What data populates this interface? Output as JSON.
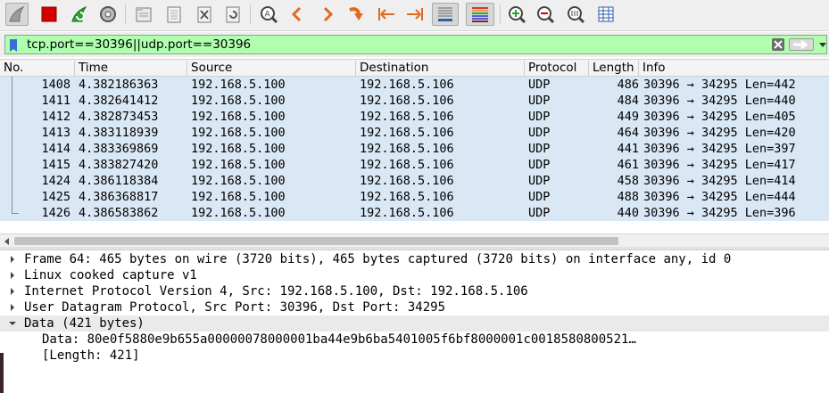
{
  "filter": {
    "value": "tcp.port==30396||udp.port==30396"
  },
  "columns": [
    "No.",
    "Time",
    "Source",
    "Destination",
    "Protocol",
    "Length",
    "Info"
  ],
  "packets": [
    {
      "no": "1408",
      "time": "4.382186363",
      "source": "192.168.5.100",
      "destination": "192.168.5.106",
      "protocol": "UDP",
      "length": "486",
      "info": "30396 → 34295 Len=442"
    },
    {
      "no": "1411",
      "time": "4.382641412",
      "source": "192.168.5.100",
      "destination": "192.168.5.106",
      "protocol": "UDP",
      "length": "484",
      "info": "30396 → 34295 Len=440"
    },
    {
      "no": "1412",
      "time": "4.382873453",
      "source": "192.168.5.100",
      "destination": "192.168.5.106",
      "protocol": "UDP",
      "length": "449",
      "info": "30396 → 34295 Len=405"
    },
    {
      "no": "1413",
      "time": "4.383118939",
      "source": "192.168.5.100",
      "destination": "192.168.5.106",
      "protocol": "UDP",
      "length": "464",
      "info": "30396 → 34295 Len=420"
    },
    {
      "no": "1414",
      "time": "4.383369869",
      "source": "192.168.5.100",
      "destination": "192.168.5.106",
      "protocol": "UDP",
      "length": "441",
      "info": "30396 → 34295 Len=397"
    },
    {
      "no": "1415",
      "time": "4.383827420",
      "source": "192.168.5.100",
      "destination": "192.168.5.106",
      "protocol": "UDP",
      "length": "461",
      "info": "30396 → 34295 Len=417"
    },
    {
      "no": "1424",
      "time": "4.386118384",
      "source": "192.168.5.100",
      "destination": "192.168.5.106",
      "protocol": "UDP",
      "length": "458",
      "info": "30396 → 34295 Len=414"
    },
    {
      "no": "1425",
      "time": "4.386368817",
      "source": "192.168.5.100",
      "destination": "192.168.5.106",
      "protocol": "UDP",
      "length": "488",
      "info": "30396 → 34295 Len=444"
    },
    {
      "no": "1426",
      "time": "4.386583862",
      "source": "192.168.5.100",
      "destination": "192.168.5.106",
      "protocol": "UDP",
      "length": "440",
      "info": "30396 → 34295 Len=396"
    }
  ],
  "details": [
    {
      "text": "Frame 64: 465 bytes on wire (3720 bits), 465 bytes captured (3720 bits) on interface any, id 0",
      "expander": "collapsed"
    },
    {
      "text": "Linux cooked capture v1",
      "expander": "collapsed"
    },
    {
      "text": "Internet Protocol Version 4, Src: 192.168.5.100, Dst: 192.168.5.106",
      "expander": "collapsed"
    },
    {
      "text": "User Datagram Protocol, Src Port: 30396, Dst Port: 34295",
      "expander": "collapsed"
    },
    {
      "text": "Data (421 bytes)",
      "expander": "expanded"
    },
    {
      "text": "Data: 80e0f5880e9b655a00000078000001ba44e9b6ba5401005f6bf8000001c0018580800521…",
      "expander": "none"
    },
    {
      "text": "[Length: 421]",
      "expander": "none"
    }
  ],
  "toolbar_icons": [
    "shark-fin-start-icon",
    "stop-capture-icon",
    "restart-capture-icon",
    "capture-options-icon",
    "open-file-icon",
    "save-file-icon",
    "close-file-icon",
    "reload-file-icon",
    "find-packet-icon",
    "go-back-icon",
    "go-forward-icon",
    "go-to-packet-icon",
    "go-first-icon",
    "go-last-icon",
    "autoscroll-icon",
    "colorize-icon",
    "zoom-in-icon",
    "zoom-out-icon",
    "normal-size-icon",
    "resize-columns-icon"
  ],
  "colors": {
    "filter_valid_bg": "#afffaf",
    "row_bg": "#dae8f6",
    "stop_red": "#d40000",
    "start_fin": "#9b9b9b",
    "restart_green": "#2aa52a",
    "nav_orange": "#e06a1b"
  }
}
